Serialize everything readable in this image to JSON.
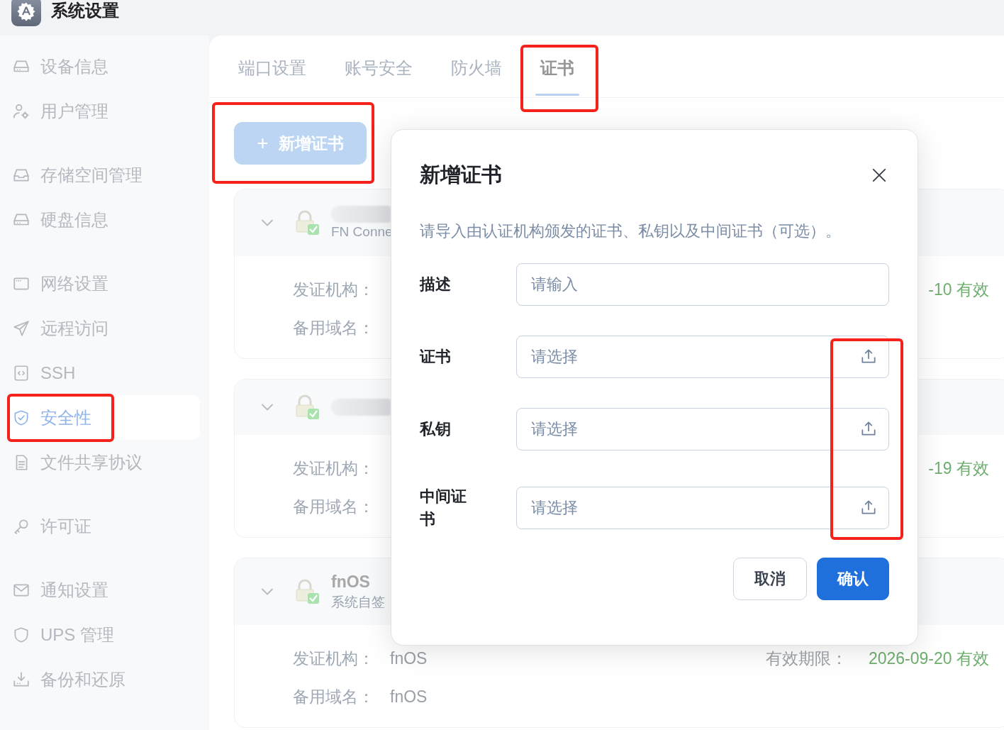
{
  "app": {
    "title": "系统设置"
  },
  "sidebar": {
    "groups": [
      {
        "items": [
          {
            "label": "设备信息",
            "selected": false,
            "highlighted": false
          },
          {
            "label": "用户管理",
            "selected": false,
            "highlighted": false
          }
        ]
      },
      {
        "items": [
          {
            "label": "存储空间管理",
            "selected": false,
            "highlighted": false
          },
          {
            "label": "硬盘信息",
            "selected": false,
            "highlighted": false
          }
        ]
      },
      {
        "items": [
          {
            "label": "网络设置",
            "selected": false,
            "highlighted": false
          },
          {
            "label": "远程访问",
            "selected": false,
            "highlighted": false
          },
          {
            "label": "SSH",
            "selected": false,
            "highlighted": false
          },
          {
            "label": "安全性",
            "selected": true,
            "highlighted": true
          },
          {
            "label": "文件共享协议",
            "selected": false,
            "highlighted": false
          }
        ]
      },
      {
        "items": [
          {
            "label": "许可证",
            "selected": false,
            "highlighted": false
          }
        ]
      },
      {
        "items": [
          {
            "label": "通知设置",
            "selected": false,
            "highlighted": false
          },
          {
            "label": "UPS 管理",
            "selected": false,
            "highlighted": false
          },
          {
            "label": "备份和还原",
            "selected": false,
            "highlighted": false
          }
        ]
      }
    ]
  },
  "tabs": [
    {
      "label": "端口设置",
      "selected": false,
      "highlighted": false
    },
    {
      "label": "账号安全",
      "selected": false,
      "highlighted": false
    },
    {
      "label": "防火墙",
      "selected": false,
      "highlighted": false
    },
    {
      "label": "证书",
      "selected": true,
      "highlighted": true
    }
  ],
  "add_button": {
    "icon": "+",
    "label": "新增证书",
    "highlighted": true
  },
  "certificates": [
    {
      "redacted": true,
      "subtitle": "FN Conne",
      "fields": [
        {
          "label": "发证机构："
        },
        {
          "label": "备用域名："
        }
      ],
      "expiry": {
        "value": "-10 有效"
      }
    },
    {
      "redacted": true,
      "fields": [
        {
          "label": "发证机构："
        },
        {
          "label": "备用域名："
        }
      ],
      "expiry": {
        "value": "-19 有效"
      }
    },
    {
      "redacted": false,
      "name": "fnOS",
      "subtitle": "系统自签",
      "fields": [
        {
          "label": "发证机构：",
          "value": "fnOS"
        },
        {
          "label": "备用域名：",
          "value": "fnOS"
        }
      ],
      "expiry": {
        "label": "有效期限：",
        "value": "2026-09-20 有效"
      }
    }
  ],
  "dialog": {
    "title": "新增证书",
    "description": "请导入由认证机构颁发的证书、私钥以及中间证书（可选）。",
    "fields": [
      {
        "label": "描述",
        "kind": "text",
        "placeholder": "请输入"
      },
      {
        "label": "证书",
        "kind": "file",
        "placeholder": "请选择"
      },
      {
        "label": "私钥",
        "kind": "file",
        "placeholder": "请选择"
      },
      {
        "label": "中间证书",
        "kind": "file",
        "placeholder": "请选择"
      }
    ],
    "upload_icons_highlighted": true,
    "buttons": [
      {
        "label": "取消",
        "kind": "secondary"
      },
      {
        "label": "确认",
        "kind": "primary"
      }
    ]
  }
}
